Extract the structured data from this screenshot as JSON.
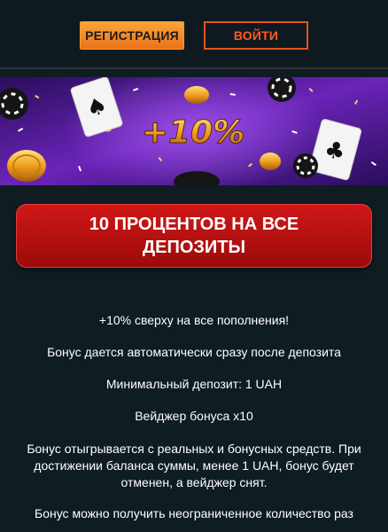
{
  "header": {
    "register_label": "РЕГИСТРАЦИЯ",
    "login_label": "ВОЙТИ"
  },
  "banner": {
    "promo_text": "+10%",
    "accent_color": "#f0a020",
    "background_color": "#4a1a8a"
  },
  "promo": {
    "title": "10 ПРОЦЕНТОВ НА ВСЕ ДЕПОЗИТЫ",
    "paragraphs": [
      "+10% сверху на все пополнения!",
      "Бонус дается автоматически сразу после депозита",
      "Минимальный депозит: 1 UAH",
      "Вейджер бонуса x10",
      "Бонус отыгрывается с реальных и бонусных средств. При достижении баланса суммы, менее 1 UAH, бонус будет отменен, а вейджер снят.",
      "Бонус можно получить неограниченное количество раз"
    ]
  }
}
